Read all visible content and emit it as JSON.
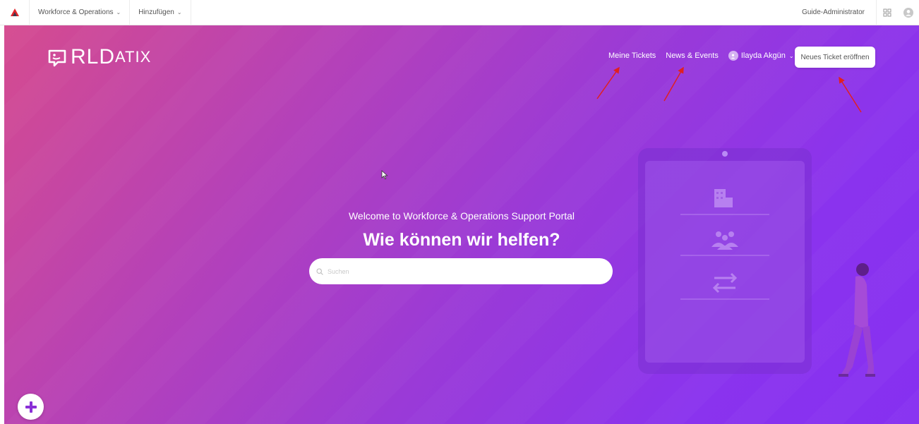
{
  "topbar": {
    "logo_icon": "rldatix-triangle-icon",
    "menu1_label": "Workforce & Operations",
    "menu2_label": "Hinzufügen",
    "role_label": "Guide-Administrator",
    "apps_icon": "apps-grid-icon",
    "profile_icon": "profile-icon"
  },
  "hero": {
    "brand_main": "RLD",
    "brand_small": "ATIX",
    "nav": {
      "tickets": "Meine Tickets",
      "news": "News & Events",
      "user_name": "Ilayda Akgün"
    },
    "cta_label": "Neues Ticket eröffnen",
    "welcome": "Welcome to Workforce & Operations Support Portal",
    "headline": "Wie können wir helfen?",
    "search_placeholder": "Suchen"
  },
  "colors": {
    "gradient_start": "#d54b8f",
    "gradient_end": "#8630f1",
    "annotation_arrow": "#e02020"
  }
}
